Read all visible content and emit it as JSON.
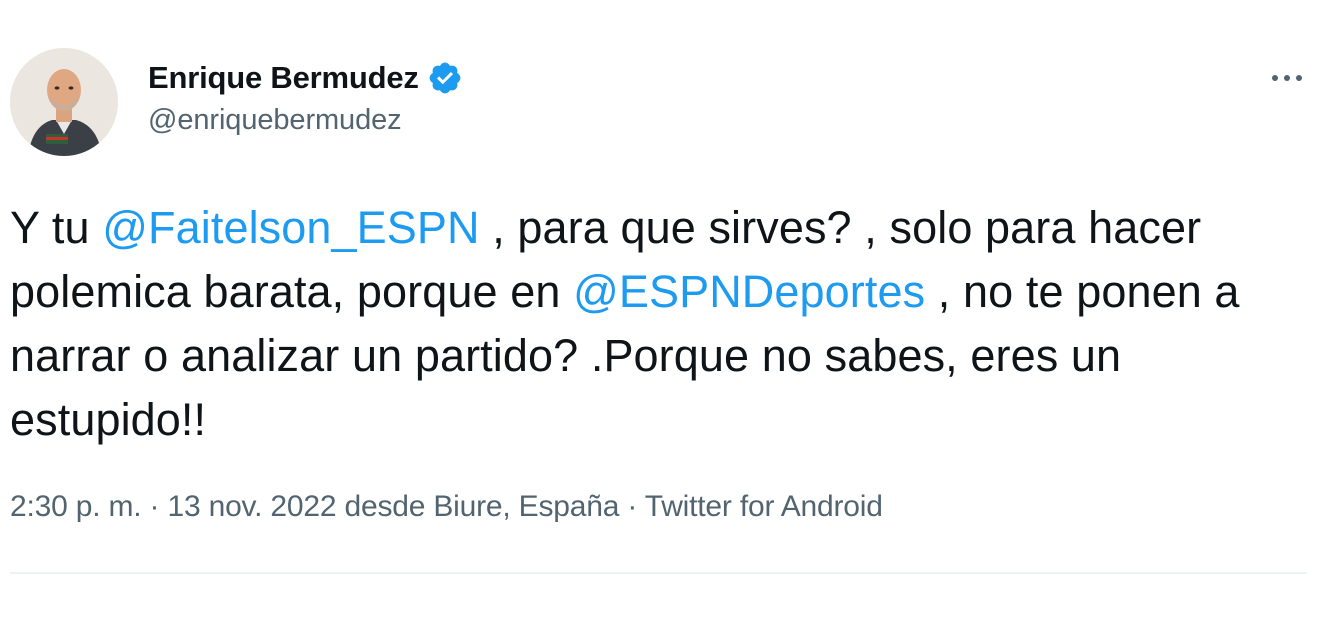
{
  "author": {
    "display_name": "Enrique Bermudez",
    "handle": "@enriquebermudez",
    "verified": true,
    "verified_color": "#1d9bf0"
  },
  "tweet": {
    "segments": [
      {
        "type": "text",
        "value": "Y tu "
      },
      {
        "type": "mention",
        "value": "@Faitelson_ESPN"
      },
      {
        "type": "text",
        "value": " , para que sirves? , solo para hacer polemica barata, porque en "
      },
      {
        "type": "mention",
        "value": "@ESPNDeportes"
      },
      {
        "type": "text",
        "value": " , no te ponen a narrar o analizar un partido? .Porque no sabes, eres un estupido!!"
      }
    ]
  },
  "meta": {
    "time": "2:30 p. m.",
    "separator": "·",
    "date": "13 nov. 2022",
    "location": "desde Biure, España",
    "client": "Twitter for Android"
  },
  "colors": {
    "mention": "#1d9bf0",
    "text": "#0f1419",
    "muted": "#536471",
    "divider": "#eff3f4"
  },
  "icons": {
    "more": "more-options-icon",
    "verified": "verified-badge-icon"
  }
}
